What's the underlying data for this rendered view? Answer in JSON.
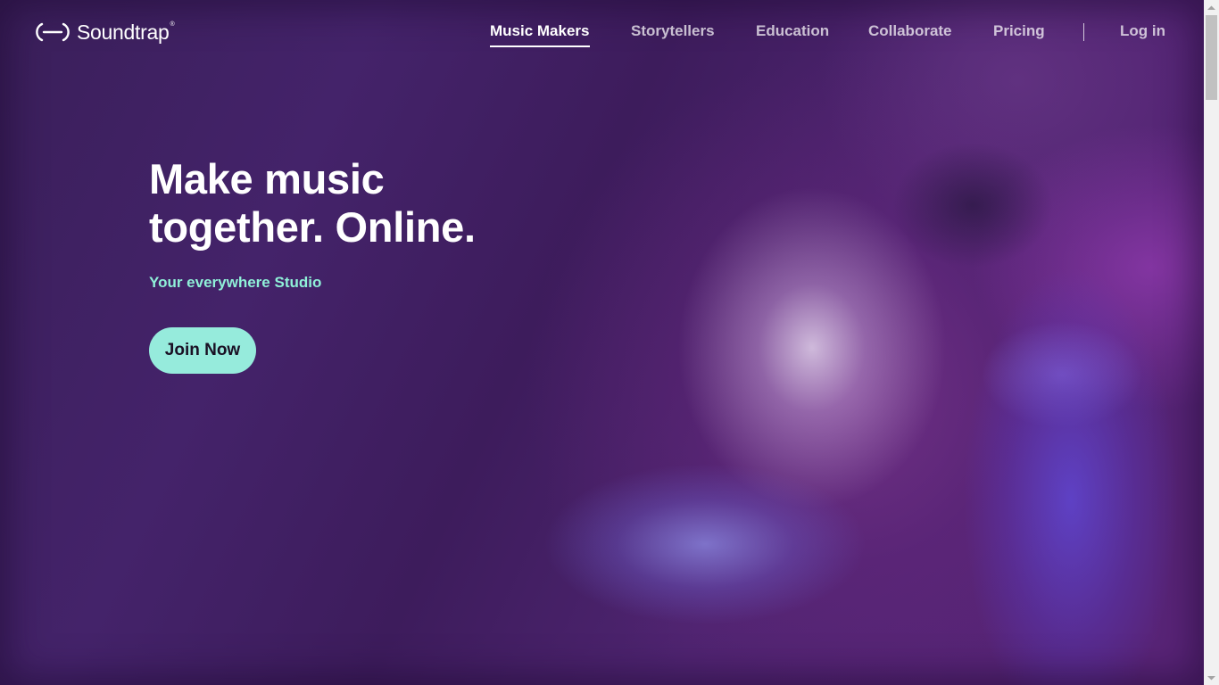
{
  "header": {
    "logo_text": "Soundtrap",
    "logo_mark": "®",
    "nav": [
      {
        "label": "Music Makers",
        "active": true
      },
      {
        "label": "Storytellers",
        "active": false
      },
      {
        "label": "Education",
        "active": false
      },
      {
        "label": "Collaborate",
        "active": false
      },
      {
        "label": "Pricing",
        "active": false
      }
    ],
    "login_label": "Log in"
  },
  "hero": {
    "title_line1": "Make music",
    "title_line2": "together. Online.",
    "subtitle": "Your everywhere Studio",
    "cta_label": "Join Now"
  },
  "colors": {
    "accent": "#96ebdc",
    "subtitle": "#8ff0d8",
    "background": "#3d1c5c"
  },
  "icons": {
    "logo": "soundtrap-logo-icon",
    "scroll_up": "arrow-up-icon",
    "scroll_down": "arrow-down-icon"
  }
}
